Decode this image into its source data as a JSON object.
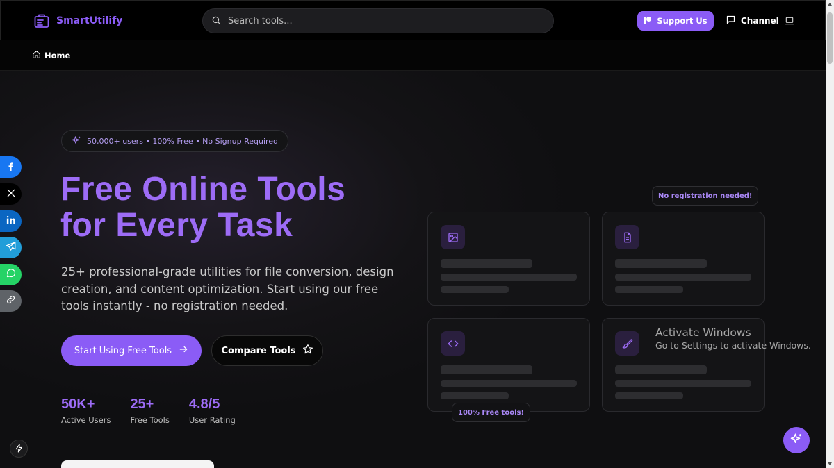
{
  "header": {
    "logo_text": "SmartUtilify",
    "search_placeholder": "Search tools...",
    "support_label": "Support Us",
    "channel_label": "Channel"
  },
  "breadcrumb": {
    "home_label": "Home"
  },
  "hero": {
    "pill_text": "50,000+ users • 100% Free • No Signup Required",
    "headline_line1": "Free Online Tools",
    "headline_line2": "for Every Task",
    "subtext": "25+ professional-grade utilities for file conversion, design creation, and content optimization. Start using our free tools instantly - no registration needed.",
    "primary_button": "Start Using Free Tools",
    "secondary_button": "Compare Tools",
    "stats": [
      {
        "value": "50K+",
        "label": "Active Users"
      },
      {
        "value": "25+",
        "label": "Free Tools"
      },
      {
        "value": "4.8/5",
        "label": "User Rating"
      }
    ]
  },
  "cards": {
    "badge_top": "No registration needed!",
    "badge_bottom": "100% Free tools!",
    "icons": [
      "image-icon",
      "document-icon",
      "code-icon",
      "paintbrush-icon"
    ]
  },
  "watermark": {
    "title": "Activate Windows",
    "subtitle": "Go to Settings to activate Windows."
  },
  "social": [
    "facebook-icon",
    "x-icon",
    "linkedin-icon",
    "telegram-icon",
    "whatsapp-icon",
    "link-icon"
  ],
  "colors": {
    "accent": "#8b5cf6",
    "headline": "#9d6cf6",
    "facebook": "#1877f2",
    "x": "#000000",
    "linkedin": "#0a66c2",
    "telegram": "#229ed9",
    "whatsapp": "#25d366",
    "link": "#5f6368"
  }
}
